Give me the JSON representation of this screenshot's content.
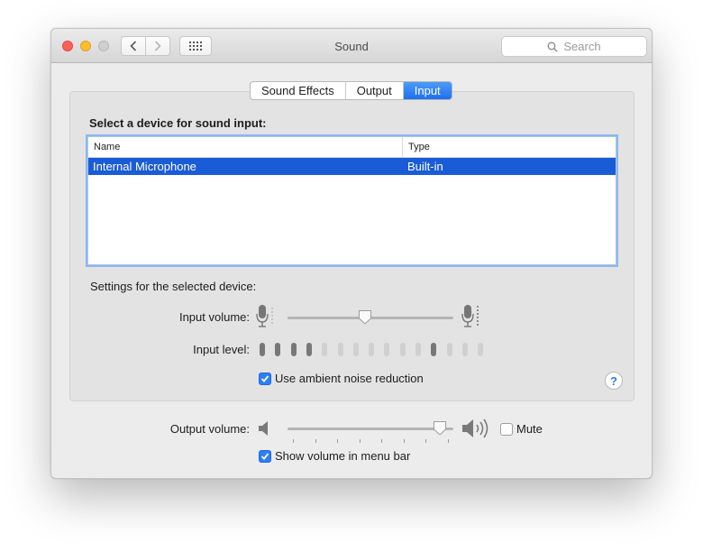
{
  "window": {
    "title": "Sound"
  },
  "search": {
    "placeholder": "Search"
  },
  "tabs": [
    {
      "label": "Sound Effects",
      "active": false
    },
    {
      "label": "Output",
      "active": false
    },
    {
      "label": "Input",
      "active": true
    }
  ],
  "input_section": {
    "title": "Select a device for sound input:",
    "columns": [
      "Name",
      "Type"
    ],
    "rows": [
      {
        "name": "Internal Microphone",
        "type": "Built-in",
        "selected": true
      }
    ]
  },
  "settings": {
    "label": "Settings for the selected device:",
    "input_volume_label": "Input volume:",
    "input_volume_value": 0.47,
    "input_level_label": "Input level:",
    "input_level_bars": [
      1,
      1,
      1,
      1,
      0,
      0,
      0,
      0,
      0,
      0,
      0,
      1,
      0,
      0,
      0
    ],
    "ambient_noise_reduction_label": "Use ambient noise reduction",
    "ambient_noise_reduction_checked": true,
    "help_label": "?"
  },
  "output": {
    "volume_label": "Output volume:",
    "volume_value": 0.92,
    "mute_label": "Mute",
    "mute_checked": false,
    "show_in_menu_bar_label": "Show volume in menu bar",
    "show_in_menu_bar_checked": true
  },
  "colors": {
    "accent": "#2a7ff5",
    "selection": "#1a5cd6"
  }
}
